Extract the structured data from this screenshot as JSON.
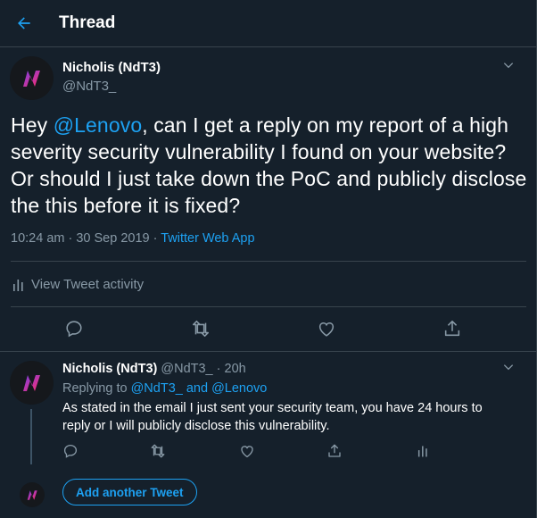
{
  "header": {
    "title": "Thread",
    "back_icon": "arrow-left-icon"
  },
  "main_tweet": {
    "name": "Nicholis (NdT3)",
    "handle": "@NdT3_",
    "text_before": "Hey ",
    "mention": "@Lenovo",
    "text_after": ", can I get a reply on my report of a high severity security vulnerability I found on your website? Or should I just take down the PoC and publicly disclose the this before it is fixed?",
    "timestamp": "10:24 am · 30 Sep 2019 · ",
    "source": "Twitter Web App",
    "activity_label": "View Tweet activity"
  },
  "reply_tweet": {
    "name": "Nicholis (NdT3)",
    "handle": "@NdT3_",
    "time": " · 20h",
    "replying_prefix": "Replying to ",
    "replying_mentions": "@NdT3_ and @Lenovo",
    "text": "As stated in the email I just sent your security team, you have 24 hours to reply or I will publicly disclose this vulnerability."
  },
  "add_tweet": {
    "label": "Add another Tweet"
  },
  "colors": {
    "background": "#15202b",
    "accent": "#1da1f2",
    "muted": "#8899a6",
    "border": "#38444d"
  },
  "icons": [
    "arrow-left-icon",
    "chevron-down-icon",
    "reply-icon",
    "retweet-icon",
    "like-icon",
    "share-icon",
    "analytics-icon"
  ]
}
